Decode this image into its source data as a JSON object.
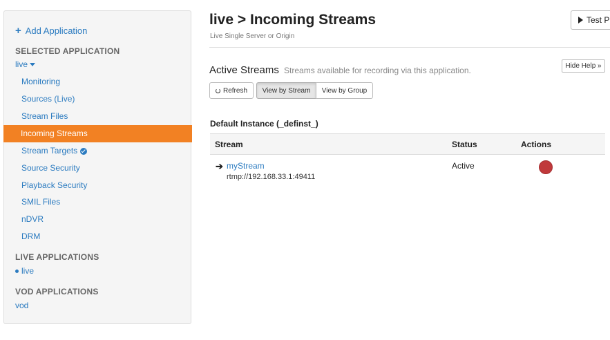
{
  "sidebar": {
    "add_application": "Add Application",
    "selected_heading": "SELECTED APPLICATION",
    "selected_app": "live",
    "items": [
      {
        "label": "Monitoring"
      },
      {
        "label": "Sources (Live)"
      },
      {
        "label": "Stream Files"
      },
      {
        "label": "Incoming Streams"
      },
      {
        "label": "Stream Targets"
      },
      {
        "label": "Source Security"
      },
      {
        "label": "Playback Security"
      },
      {
        "label": "SMIL Files"
      },
      {
        "label": "nDVR"
      },
      {
        "label": "DRM"
      }
    ],
    "live_heading": "LIVE APPLICATIONS",
    "live_apps": [
      "live"
    ],
    "vod_heading": "VOD APPLICATIONS",
    "vod_apps": [
      "vod"
    ]
  },
  "header": {
    "title": "live > Incoming Streams",
    "subtitle": "Live Single Server or Origin",
    "test_button": "Test Pl"
  },
  "active_streams": {
    "title": "Active Streams",
    "help": "Streams available for recording via this application.",
    "hide_help": "Hide Help »",
    "refresh": "Refresh",
    "view_by_stream": "View by Stream",
    "view_by_group": "View by Group"
  },
  "instance": {
    "title": "Default Instance (_definst_)",
    "columns": [
      "Stream",
      "Status",
      "Actions"
    ],
    "rows": [
      {
        "name": "myStream",
        "source": "rtmp://192.168.33.1:49411",
        "status": "Active"
      }
    ]
  },
  "colors": {
    "accent": "#f28123",
    "link": "#2b7bc0",
    "record": "#c0393b"
  }
}
